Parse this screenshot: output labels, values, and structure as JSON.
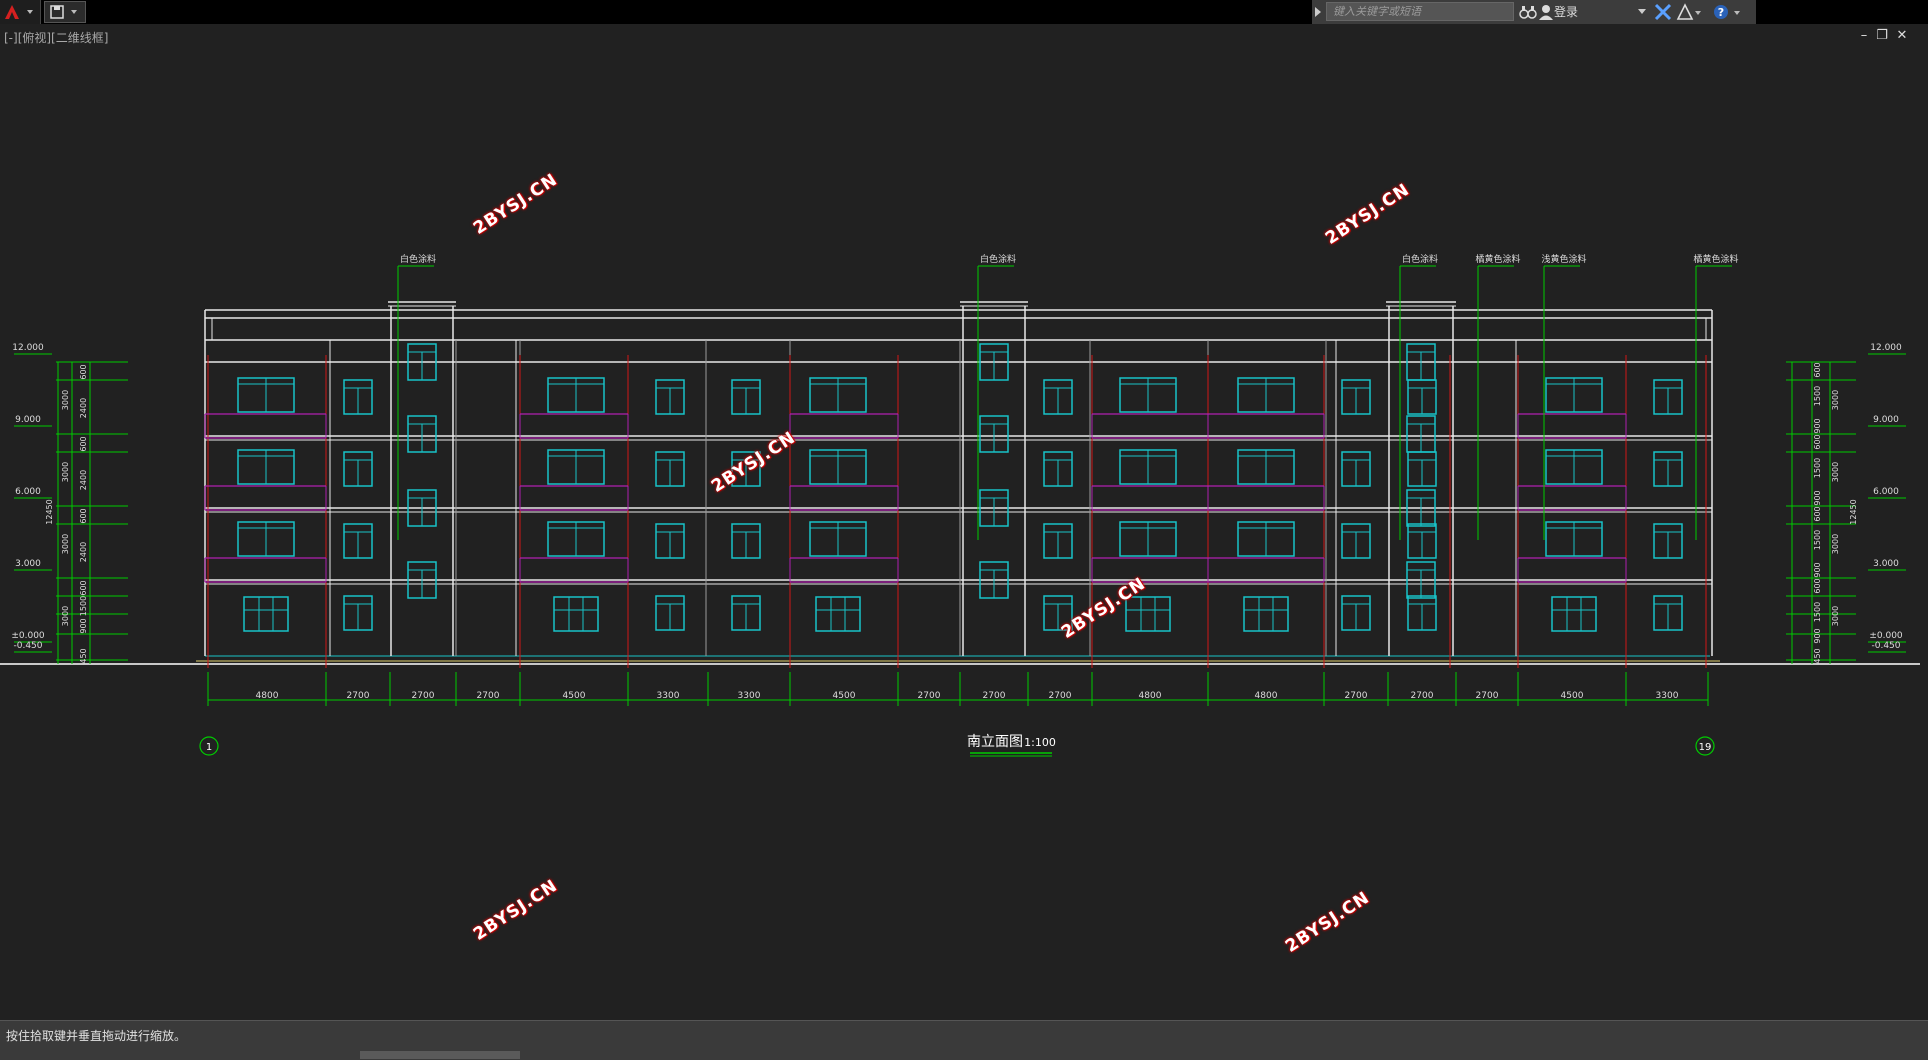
{
  "toolbar": {
    "search_placeholder": "键入关键字或短语",
    "login_label": "登录"
  },
  "viewport": {
    "label": "[-][俯视][二维线框]"
  },
  "window_controls": {
    "minimize": "–",
    "restore": "❐",
    "close": "✕"
  },
  "drawing": {
    "title": "南立面图",
    "scale": "1:100",
    "axis_start": "1",
    "axis_end": "19",
    "bay_dims": [
      "4800",
      "2700",
      "2700",
      "2700",
      "4500",
      "3300",
      "3300",
      "4500",
      "2700",
      "2700",
      "2700",
      "4800",
      "4800",
      "2700",
      "2700",
      "2700",
      "4500",
      "3300"
    ],
    "left_elevations": [
      "12.000",
      "9.000",
      "6.000",
      "3.000",
      "±0.000",
      "-0.450"
    ],
    "right_elevations": [
      "12.000",
      "9.000",
      "6.000",
      "3.000",
      "±0.000",
      "-0.450"
    ],
    "left_dims_inner": [
      "600",
      "2400",
      "600",
      "2400",
      "600",
      "2400",
      "600",
      "1500",
      "900",
      "450"
    ],
    "left_dims_outer": [
      "3000",
      "3000",
      "3000",
      "3000"
    ],
    "total_height": "12450",
    "right_dims_inner": [
      "600",
      "1500",
      "900",
      "600",
      "1500",
      "900",
      "600",
      "1500",
      "900",
      "600",
      "1500",
      "900",
      "450"
    ],
    "right_dims_outer": [
      "3000",
      "3000",
      "3000",
      "3000"
    ],
    "material_labels": [
      "白色涂料",
      "白色涂料",
      "白色涂料",
      "橘黄色涂料",
      "浅黄色涂料",
      "橘黄色涂料"
    ]
  },
  "watermark": "2BYSJ.CN",
  "status": {
    "prompt": "按住拾取键并垂直拖动进行缩放。"
  },
  "colors": {
    "line": "#00cc00",
    "window": "#19c3c8",
    "wall": "#e8e8e8",
    "red": "#d01818",
    "magenta": "#b020b0"
  }
}
